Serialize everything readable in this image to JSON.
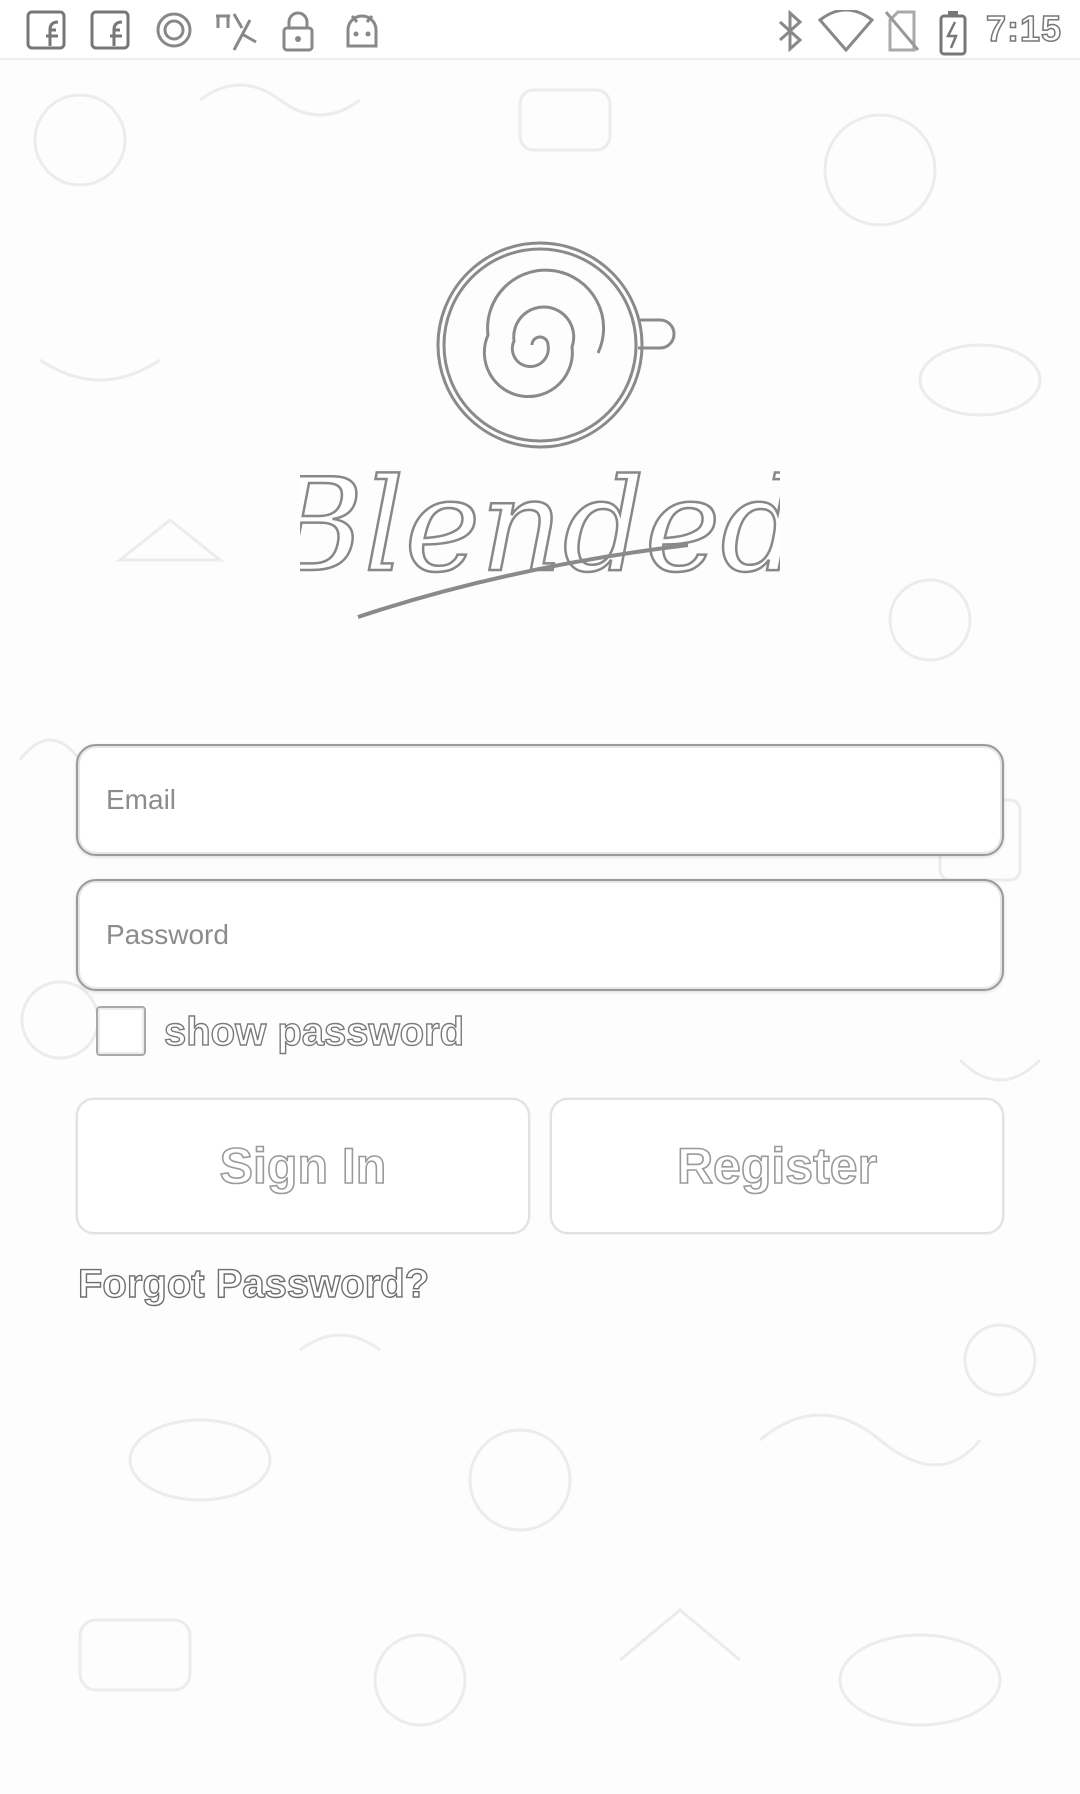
{
  "status_bar": {
    "time": "7:15",
    "left_icons": [
      "facebook-icon",
      "facebook-icon",
      "circle-icon",
      "app-icon",
      "lock-icon",
      "android-icon"
    ],
    "right_icons": [
      "bluetooth-icon",
      "wifi-icon",
      "no-sim-icon",
      "battery-charging-icon"
    ]
  },
  "logo": {
    "text": "Blended"
  },
  "login": {
    "email_placeholder": "Email",
    "password_placeholder": "Password",
    "show_password_label": "show password",
    "sign_in_label": "Sign In",
    "register_label": "Register",
    "forgot_label": "Forgot Password?"
  }
}
